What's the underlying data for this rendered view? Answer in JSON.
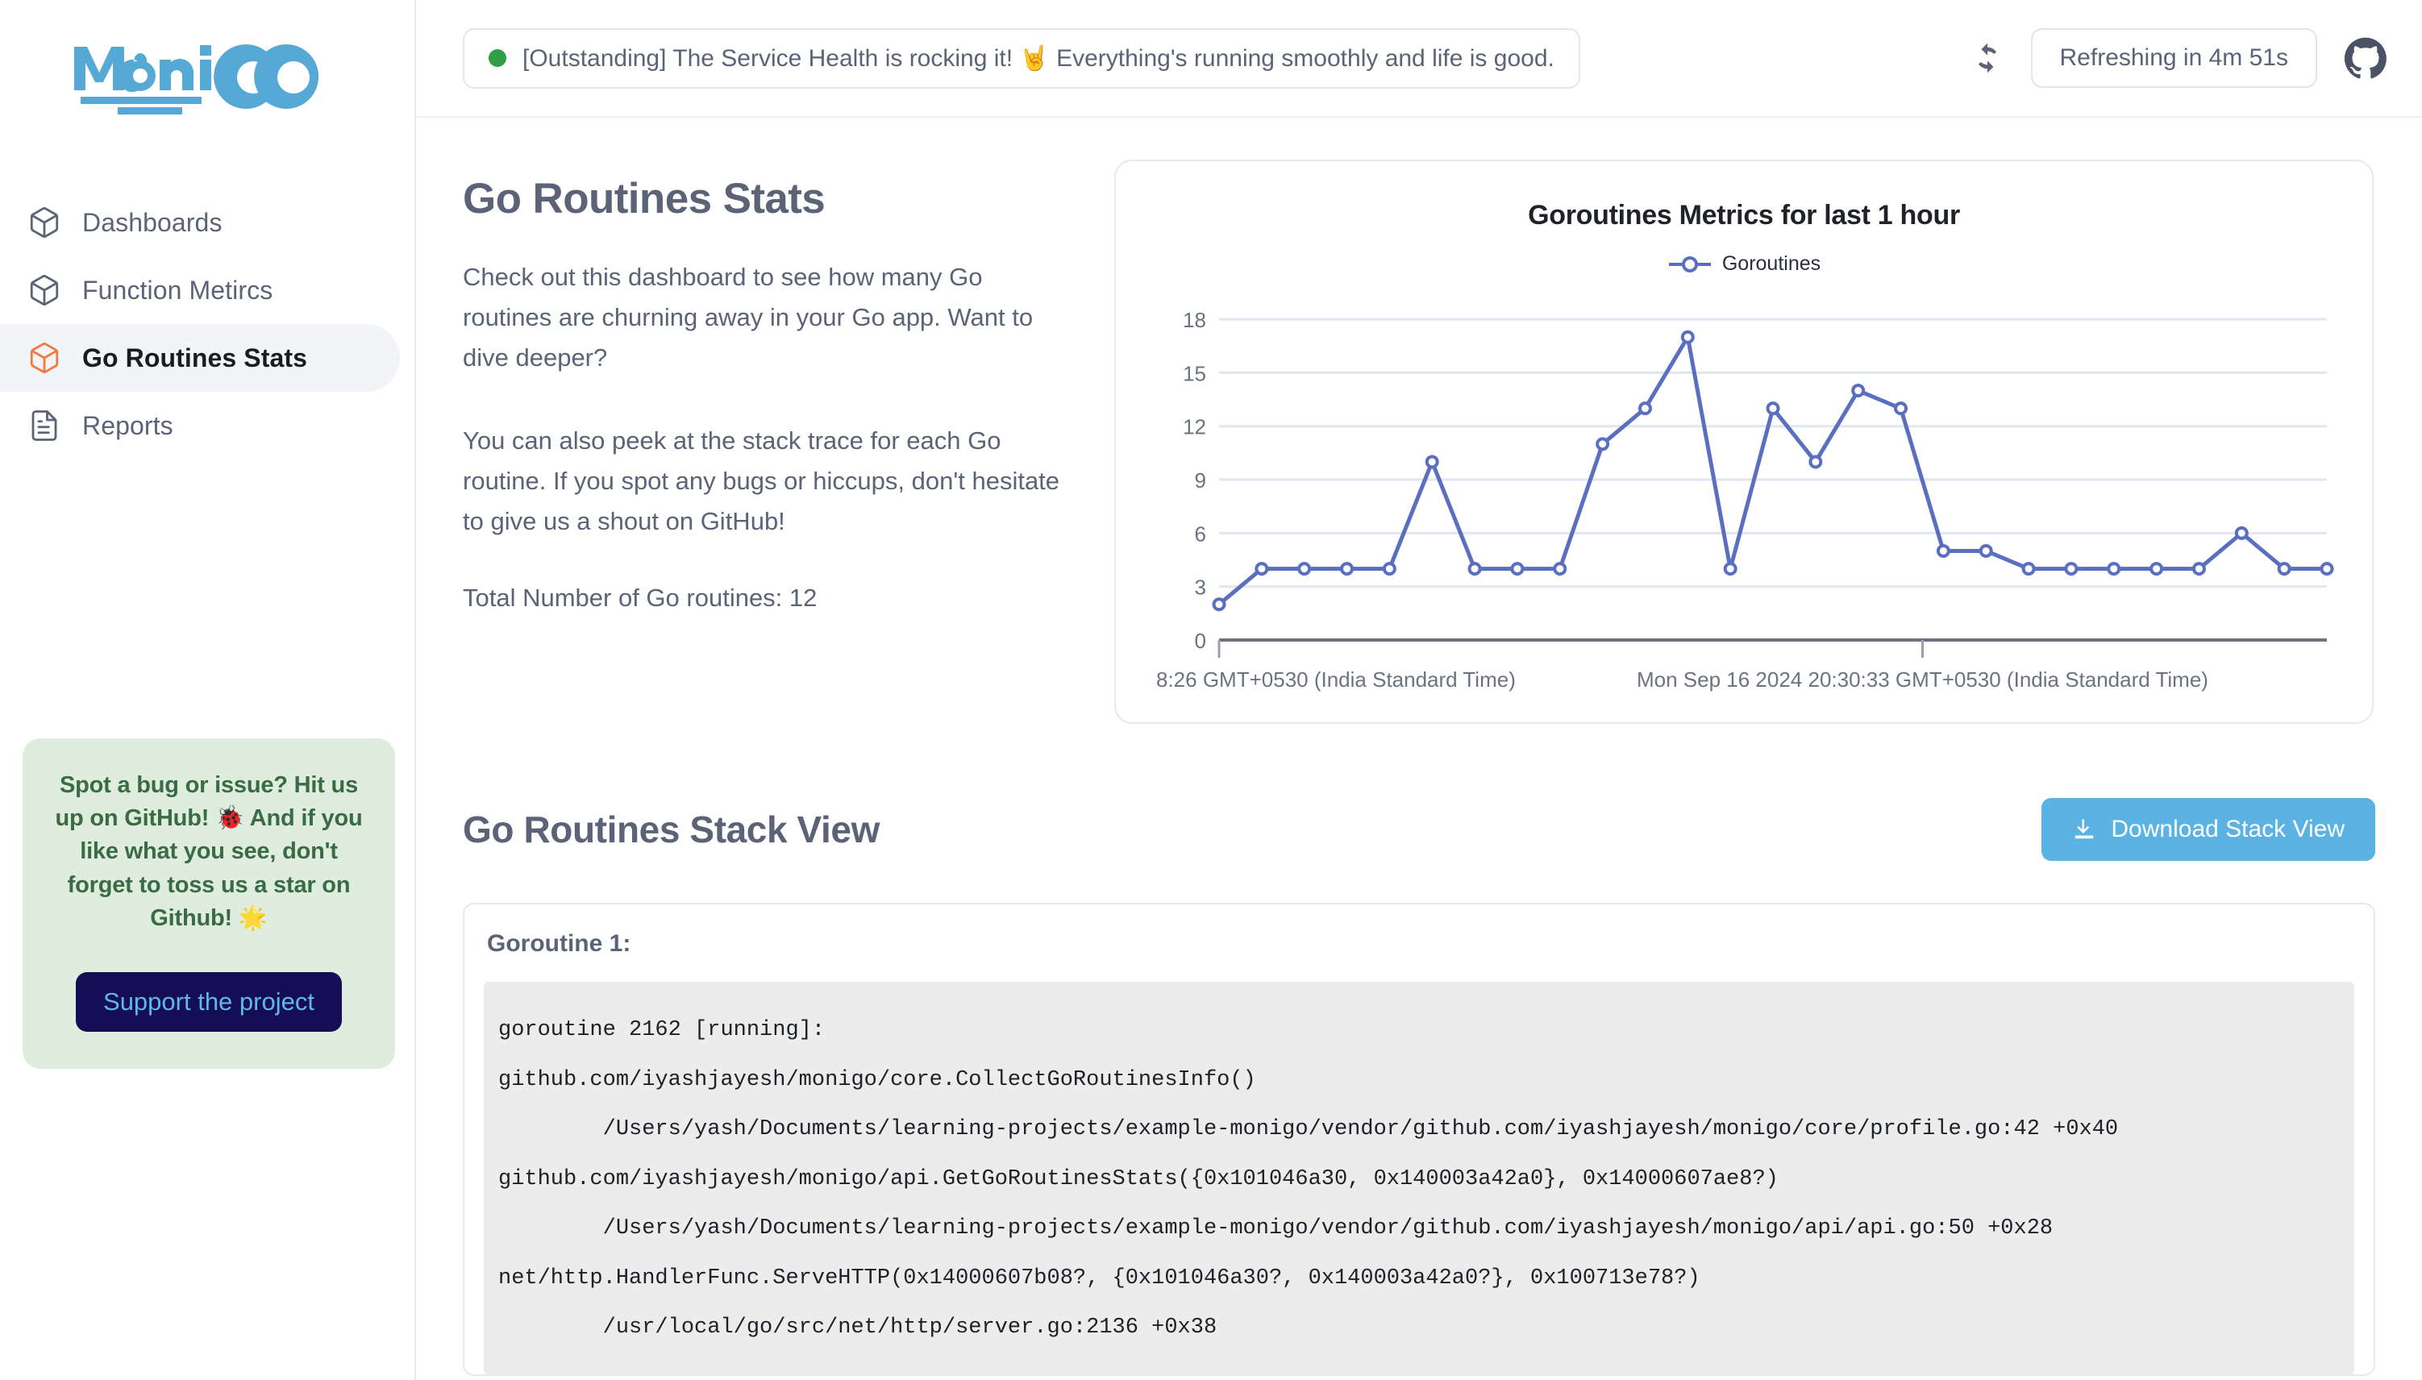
{
  "brand": {
    "name_part1": "Moni",
    "name_part2": "GO"
  },
  "sidebar": {
    "items": [
      {
        "label": "Dashboards",
        "icon": "box-icon",
        "active": false
      },
      {
        "label": "Function Metircs",
        "icon": "box-icon",
        "active": false
      },
      {
        "label": "Go Routines Stats",
        "icon": "box-icon",
        "active": true
      },
      {
        "label": "Reports",
        "icon": "document-icon",
        "active": false
      }
    ],
    "promo": {
      "text": "Spot a bug or issue? Hit us up on GitHub! 🐞 And if you like what you see, don't forget to toss us a star on Github! 🌟",
      "button_label": "Support the project",
      "bg_color": "#dfeddf",
      "text_color": "#3a6b44",
      "button_bg": "#150d56",
      "button_text_color": "#5fb9e6"
    }
  },
  "topbar": {
    "status_text": "[Outstanding] The Service Health is rocking it! 🤘 Everything's running smoothly and life is good.",
    "status_dot_color": "#2f9e44",
    "refresh_icon": "refresh-icon",
    "refresh_label": "Refreshing in 4m 51s",
    "github_icon": "github-icon"
  },
  "main": {
    "page_title": "Go Routines Stats",
    "paragraph_1": "Check out this dashboard to see how many Go routines are churning away in your Go app. Want to dive deeper?",
    "paragraph_2": "You can also peek at the stack trace for each Go routine. If you spot any bugs or hiccups, don't hesitate to give us a shout on GitHub!",
    "total_routines_label": "Total Number of Go routines: 12",
    "stack_section_title": "Go Routines Stack View",
    "download_button_label": "Download Stack View",
    "download_icon": "download-icon",
    "goroutine_label": "Goroutine 1:",
    "stack_trace": "goroutine 2162 [running]:\ngithub.com/iyashjayesh/monigo/core.CollectGoRoutinesInfo()\n        /Users/yash/Documents/learning-projects/example-monigo/vendor/github.com/iyashjayesh/monigo/core/profile.go:42 +0x40\ngithub.com/iyashjayesh/monigo/api.GetGoRoutinesStats({0x101046a30, 0x140003a42a0}, 0x14000607ae8?)\n        /Users/yash/Documents/learning-projects/example-monigo/vendor/github.com/iyashjayesh/monigo/api/api.go:50 +0x28\nnet/http.HandlerFunc.ServeHTTP(0x14000607b08?, {0x101046a30?, 0x140003a42a0?}, 0x100713e78?)\n        /usr/local/go/src/net/http/server.go:2136 +0x38"
  },
  "chart_data": {
    "type": "line",
    "title": "Goroutines Metrics for last 1 hour",
    "xlabel": "",
    "ylabel": "",
    "ylim": [
      0,
      19
    ],
    "yticks": [
      0,
      3,
      6,
      9,
      12,
      15,
      18
    ],
    "grid": true,
    "legend_position": "top-center",
    "line_color": "#5a6fc0",
    "xtick_labels": [
      "8:26 GMT+0530 (India Standard Time)",
      "Mon Sep 16 2024 20:30:33 GMT+0530 (India Standard Time)"
    ],
    "series": [
      {
        "name": "Goroutines",
        "values": [
          2,
          4,
          4,
          4,
          4,
          10,
          4,
          4,
          4,
          11,
          13,
          17,
          4,
          13,
          10,
          14,
          13,
          5,
          5,
          4,
          4,
          4,
          4,
          4,
          6,
          4,
          4
        ]
      }
    ]
  }
}
